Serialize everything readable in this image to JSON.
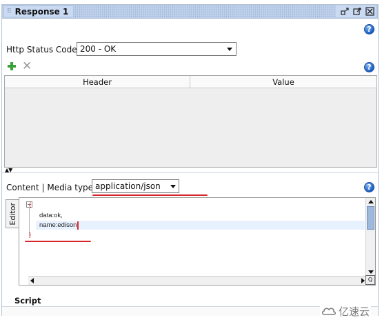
{
  "window": {
    "title": "Response 1",
    "title_icon": "grid-dots-icon",
    "buttons": [
      "restore-icon",
      "maximize-icon",
      "close-icon"
    ]
  },
  "status": {
    "label": "Http Status Code:",
    "value": "200 - OK"
  },
  "headers_table": {
    "columns": [
      "Header",
      "Value"
    ],
    "rows": []
  },
  "content": {
    "label": "Content | Media type:",
    "media_type": "application/json"
  },
  "editor": {
    "tab_label": "Editor",
    "lines": [
      "{",
      "data:ok,",
      "name:edison",
      "}"
    ]
  },
  "bottom_tab": "Script",
  "watermark": "亿速云",
  "colors": {
    "accent_red": "#d8252b",
    "title_bar": "#c9daf2",
    "add_green": "#3aa03a"
  }
}
